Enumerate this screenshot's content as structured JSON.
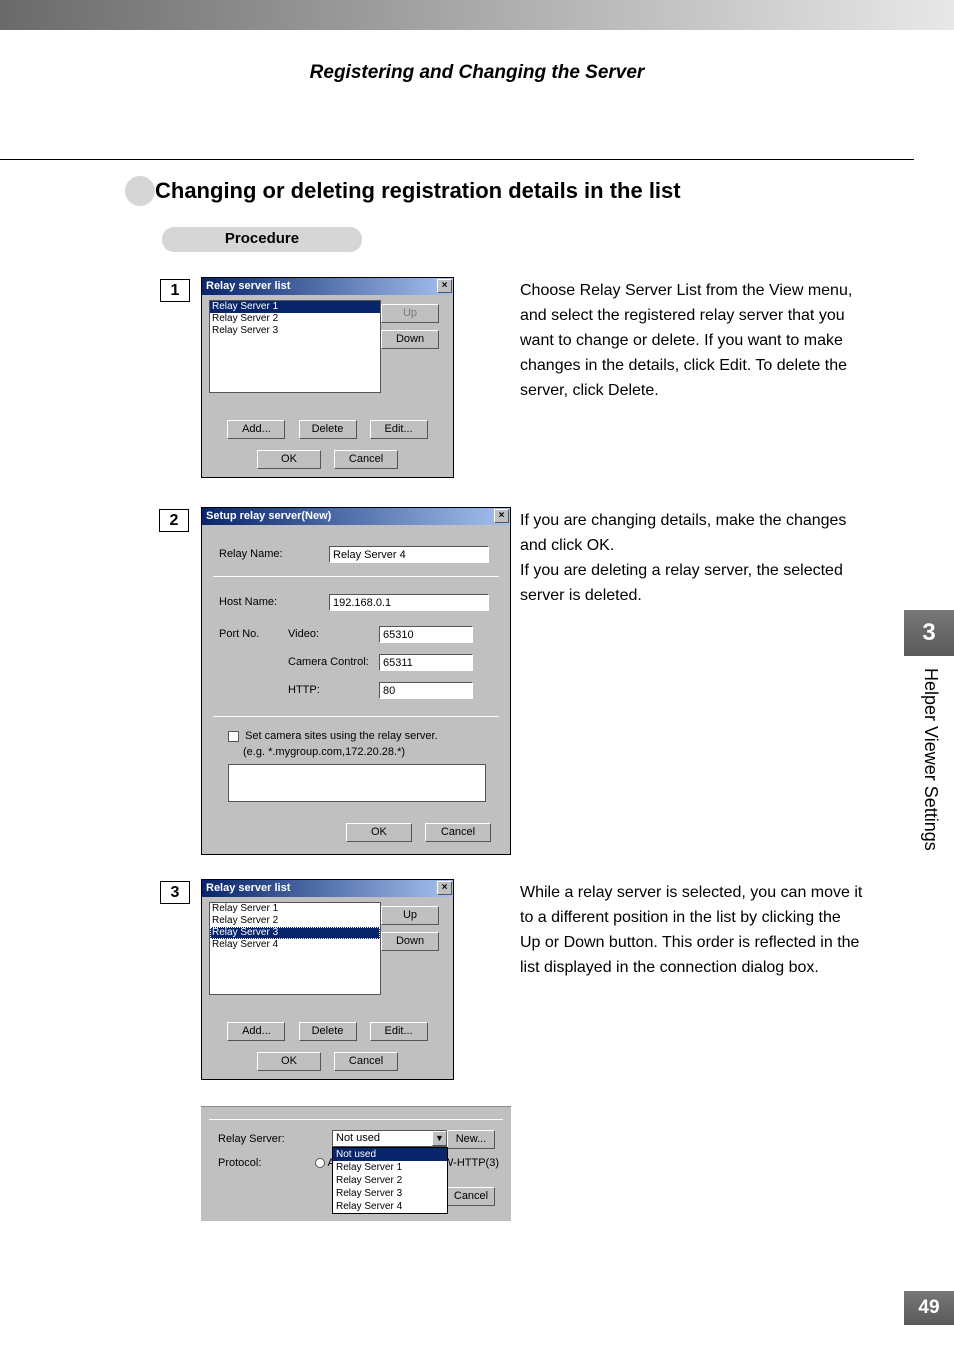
{
  "running_header": "Registering and Changing the Server",
  "section_heading": "Changing or deleting registration details in the list",
  "procedure_label": "Procedure",
  "steps": {
    "num1": "1",
    "num2": "2",
    "num3": "3"
  },
  "explain": {
    "step1": "Choose Relay Server List from the View menu, and select the registered relay server that you want to change or delete. If you want to make changes in the details, click Edit. To delete the server, click Delete.",
    "step2a": "If you are changing details, make the changes and click OK.",
    "step2b": "If you are deleting a relay server, the selected server is deleted.",
    "step3": "While a relay server is selected, you can move it to a different position in the list by clicking the Up or Down button. This order is reflected in the list displayed in the connection dialog box."
  },
  "side_tab": {
    "num": "3",
    "label": "Helper Viewer Settings"
  },
  "page_number": "49",
  "dlg1": {
    "title": "Relay server list",
    "items": [
      "Relay Server 1",
      "Relay Server 2",
      "Relay Server 3"
    ],
    "up": "Up",
    "down": "Down",
    "add": "Add...",
    "delete": "Delete",
    "edit": "Edit...",
    "ok": "OK",
    "cancel": "Cancel"
  },
  "dlg2": {
    "title": "Setup relay server(New)",
    "relay_name_lbl": "Relay Name:",
    "relay_name_val": "Relay Server 4",
    "host_name_lbl": "Host Name:",
    "host_name_val": "192.168.0.1",
    "port_lbl": "Port No.",
    "video_lbl": "Video:",
    "video_val": "65310",
    "camera_lbl": "Camera Control:",
    "camera_val": "65311",
    "http_lbl": "HTTP:",
    "http_val": "80",
    "set_sites_lbl": "Set camera sites using the relay server.",
    "example": "(e.g. *.mygroup.com,172.20.28.*)",
    "ok": "OK",
    "cancel": "Cancel"
  },
  "dlg3": {
    "title": "Relay server list",
    "items": [
      "Relay Server 1",
      "Relay Server 2",
      "Relay Server 3",
      "Relay Server 4"
    ],
    "up": "Up",
    "down": "Down",
    "add": "Add...",
    "delete": "Delete",
    "edit": "Edit...",
    "ok": "OK",
    "cancel": "Cancel"
  },
  "dlg4": {
    "relay_lbl": "Relay Server:",
    "protocol_lbl": "Protocol:",
    "selected": "Not used",
    "dd_items": [
      "Not used",
      "Relay Server 1",
      "Relay Server 2",
      "Relay Server 3",
      "Relay Server 4"
    ],
    "new_btn": "New...",
    "auto_radio": "Au",
    "whp": "W-HTTP(3)",
    "cancel": "Cancel"
  }
}
